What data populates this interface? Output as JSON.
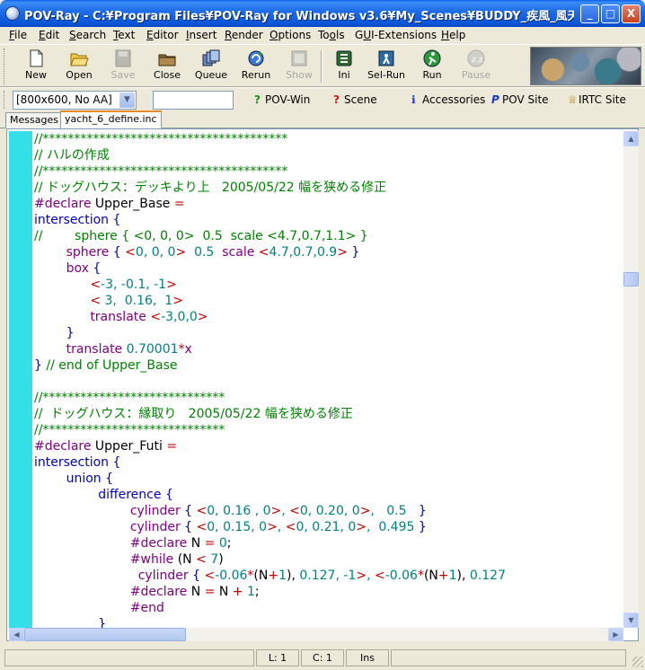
{
  "window": {
    "title": "POV-Ray - C:¥Program Files¥POV-Ray for Windows v3.6¥My_Scenes¥BUDDY_疾風_風天丸_at...",
    "minimize": "_",
    "maximize": "□",
    "close": "X"
  },
  "menu": [
    {
      "underline": "F",
      "rest": "ile"
    },
    {
      "underline": "E",
      "rest": "dit"
    },
    {
      "underline": "S",
      "rest": "earch",
      "pre": ""
    },
    {
      "underline": "T",
      "rest": "ext"
    },
    {
      "underline": "E",
      "rest": "ditor"
    },
    {
      "underline": "I",
      "rest": "nsert"
    },
    {
      "underline": "R",
      "rest": "ender"
    },
    {
      "underline": "O",
      "rest": "ptions"
    },
    {
      "underline": "o",
      "rest": "ls",
      "pre": "To"
    },
    {
      "underline": "U",
      "rest": "I-Extensions",
      "pre": "G"
    },
    {
      "underline": "H",
      "rest": "elp"
    }
  ],
  "toolbar": {
    "new": "New",
    "open": "Open",
    "save": "Save",
    "close": "Close",
    "queue": "Queue",
    "rerun": "Rerun",
    "show": "Show",
    "ini": "Ini",
    "selrun": "Sel-Run",
    "run": "Run",
    "pause": "Pause"
  },
  "bar2": {
    "resolution": "[800x600, No AA]",
    "povwin": "POV-Win",
    "scene": "Scene",
    "accessories": "Accessories",
    "povsite": "POV Site",
    "irtcsite": "IRTC Site"
  },
  "tabs": [
    "Messages",
    "yacht_6_define.inc"
  ],
  "code_lines": [
    [
      {
        "c": "com",
        "t": "//***************************************"
      }
    ],
    [
      {
        "c": "com",
        "t": "// ハルの作成"
      }
    ],
    [
      {
        "c": "com",
        "t": "//***************************************"
      }
    ],
    [
      {
        "c": "com",
        "t": "// ドッグハウス：デッキより上   2005/05/22 幅を狭める修正"
      }
    ],
    [
      {
        "c": "kw",
        "t": "#declare"
      },
      {
        "c": "",
        "t": " Upper_Base "
      },
      {
        "c": "op",
        "t": "="
      }
    ],
    [
      {
        "c": "blu",
        "t": "intersection"
      },
      {
        "c": "",
        "t": " "
      },
      {
        "c": "blu",
        "t": "{"
      }
    ],
    [
      {
        "c": "com",
        "t": "//        sphere { <0, 0, 0>  0.5  scale <4.7,0.7,1.1> }"
      }
    ],
    [
      {
        "c": "",
        "t": "        "
      },
      {
        "c": "kw",
        "t": "sphere"
      },
      {
        "c": "",
        "t": " "
      },
      {
        "c": "blu",
        "t": "{"
      },
      {
        "c": "",
        "t": " "
      },
      {
        "c": "op",
        "t": "<"
      },
      {
        "c": "num",
        "t": "0, 0, 0"
      },
      {
        "c": "op",
        "t": ">"
      },
      {
        "c": "",
        "t": "  "
      },
      {
        "c": "num",
        "t": "0.5"
      },
      {
        "c": "",
        "t": "  "
      },
      {
        "c": "kw",
        "t": "scale"
      },
      {
        "c": "",
        "t": " "
      },
      {
        "c": "op",
        "t": "<"
      },
      {
        "c": "num",
        "t": "4.7,0.7,0.9"
      },
      {
        "c": "op",
        "t": ">"
      },
      {
        "c": "",
        "t": " "
      },
      {
        "c": "blu",
        "t": "}"
      }
    ],
    [
      {
        "c": "",
        "t": "        "
      },
      {
        "c": "kw",
        "t": "box"
      },
      {
        "c": "",
        "t": " "
      },
      {
        "c": "blu",
        "t": "{"
      }
    ],
    [
      {
        "c": "",
        "t": "              "
      },
      {
        "c": "op",
        "t": "<"
      },
      {
        "c": "num",
        "t": "-3, -0.1, -1"
      },
      {
        "c": "op",
        "t": ">"
      }
    ],
    [
      {
        "c": "",
        "t": "              "
      },
      {
        "c": "op",
        "t": "<"
      },
      {
        "c": "num",
        "t": " 3,  0.16,  1"
      },
      {
        "c": "op",
        "t": ">"
      }
    ],
    [
      {
        "c": "",
        "t": "              "
      },
      {
        "c": "kw",
        "t": "translate"
      },
      {
        "c": "",
        "t": " "
      },
      {
        "c": "op",
        "t": "<"
      },
      {
        "c": "num",
        "t": "-3,0,0"
      },
      {
        "c": "op",
        "t": ">"
      }
    ],
    [
      {
        "c": "",
        "t": "        "
      },
      {
        "c": "blu",
        "t": "}"
      }
    ],
    [
      {
        "c": "",
        "t": "        "
      },
      {
        "c": "kw",
        "t": "translate"
      },
      {
        "c": "",
        "t": " "
      },
      {
        "c": "num",
        "t": "0.70001"
      },
      {
        "c": "op",
        "t": "*"
      },
      {
        "c": "kw",
        "t": "x"
      }
    ],
    [
      {
        "c": "blu",
        "t": "}"
      },
      {
        "c": "",
        "t": " "
      },
      {
        "c": "com",
        "t": "// end of Upper_Base"
      }
    ],
    [
      {
        "c": "",
        "t": ""
      }
    ],
    [
      {
        "c": "com",
        "t": "//*****************************"
      }
    ],
    [
      {
        "c": "com",
        "t": "//  ドッグハウス：縁取り   2005/05/22 幅を狭める修正"
      }
    ],
    [
      {
        "c": "com",
        "t": "//*****************************"
      }
    ],
    [
      {
        "c": "kw",
        "t": "#declare"
      },
      {
        "c": "",
        "t": " Upper_Futi "
      },
      {
        "c": "op",
        "t": "="
      }
    ],
    [
      {
        "c": "blu",
        "t": "intersection"
      },
      {
        "c": "",
        "t": " "
      },
      {
        "c": "blu",
        "t": "{"
      }
    ],
    [
      {
        "c": "",
        "t": "        "
      },
      {
        "c": "blu",
        "t": "union"
      },
      {
        "c": "",
        "t": " "
      },
      {
        "c": "blu",
        "t": "{"
      }
    ],
    [
      {
        "c": "",
        "t": "                "
      },
      {
        "c": "blu",
        "t": "difference"
      },
      {
        "c": "",
        "t": " "
      },
      {
        "c": "blu",
        "t": "{"
      }
    ],
    [
      {
        "c": "",
        "t": "                        "
      },
      {
        "c": "kw",
        "t": "cylinder"
      },
      {
        "c": "",
        "t": " "
      },
      {
        "c": "blu",
        "t": "{"
      },
      {
        "c": "",
        "t": " "
      },
      {
        "c": "op",
        "t": "<"
      },
      {
        "c": "num",
        "t": "0, 0.16 , 0"
      },
      {
        "c": "op",
        "t": ">"
      },
      {
        "c": "num",
        "t": ", "
      },
      {
        "c": "op",
        "t": "<"
      },
      {
        "c": "num",
        "t": "0, 0.20, 0"
      },
      {
        "c": "op",
        "t": ">"
      },
      {
        "c": "num",
        "t": ",   0.5   "
      },
      {
        "c": "blu",
        "t": "}"
      }
    ],
    [
      {
        "c": "",
        "t": "                        "
      },
      {
        "c": "kw",
        "t": "cylinder"
      },
      {
        "c": "",
        "t": " "
      },
      {
        "c": "blu",
        "t": "{"
      },
      {
        "c": "",
        "t": " "
      },
      {
        "c": "op",
        "t": "<"
      },
      {
        "c": "num",
        "t": "0, 0.15, 0"
      },
      {
        "c": "op",
        "t": ">"
      },
      {
        "c": "num",
        "t": ", "
      },
      {
        "c": "op",
        "t": "<"
      },
      {
        "c": "num",
        "t": "0, 0.21, 0"
      },
      {
        "c": "op",
        "t": ">"
      },
      {
        "c": "num",
        "t": ",  0.495 "
      },
      {
        "c": "blu",
        "t": "}"
      }
    ],
    [
      {
        "c": "",
        "t": "                        "
      },
      {
        "c": "kw",
        "t": "#declare"
      },
      {
        "c": "",
        "t": " N "
      },
      {
        "c": "op",
        "t": "="
      },
      {
        "c": "",
        "t": " "
      },
      {
        "c": "num",
        "t": "0"
      },
      {
        "c": "",
        "t": ";"
      }
    ],
    [
      {
        "c": "",
        "t": "                        "
      },
      {
        "c": "kw",
        "t": "#while"
      },
      {
        "c": "",
        "t": " (N "
      },
      {
        "c": "op",
        "t": "<"
      },
      {
        "c": "",
        "t": " "
      },
      {
        "c": "num",
        "t": "7"
      },
      {
        "c": "",
        "t": ")"
      }
    ],
    [
      {
        "c": "",
        "t": "                          "
      },
      {
        "c": "kw",
        "t": "cylinder"
      },
      {
        "c": "",
        "t": " "
      },
      {
        "c": "blu",
        "t": "{"
      },
      {
        "c": "",
        "t": " "
      },
      {
        "c": "op",
        "t": "<"
      },
      {
        "c": "num",
        "t": "-0.06"
      },
      {
        "c": "op",
        "t": "*"
      },
      {
        "c": "",
        "t": "(N"
      },
      {
        "c": "op",
        "t": "+"
      },
      {
        "c": "num",
        "t": "1"
      },
      {
        "c": "",
        "t": "), "
      },
      {
        "c": "num",
        "t": "0.127, -1"
      },
      {
        "c": "op",
        "t": ">"
      },
      {
        "c": "num",
        "t": ", "
      },
      {
        "c": "op",
        "t": "<"
      },
      {
        "c": "num",
        "t": "-0.06"
      },
      {
        "c": "op",
        "t": "*"
      },
      {
        "c": "",
        "t": "(N"
      },
      {
        "c": "op",
        "t": "+"
      },
      {
        "c": "num",
        "t": "1"
      },
      {
        "c": "",
        "t": "), "
      },
      {
        "c": "num",
        "t": "0.127"
      }
    ],
    [
      {
        "c": "",
        "t": "                        "
      },
      {
        "c": "kw",
        "t": "#declare"
      },
      {
        "c": "",
        "t": " N "
      },
      {
        "c": "op",
        "t": "="
      },
      {
        "c": "",
        "t": " N "
      },
      {
        "c": "op",
        "t": "+"
      },
      {
        "c": "",
        "t": " "
      },
      {
        "c": "num",
        "t": "1"
      },
      {
        "c": "",
        "t": ";"
      }
    ],
    [
      {
        "c": "",
        "t": "                        "
      },
      {
        "c": "kw",
        "t": "#end"
      }
    ],
    [
      {
        "c": "",
        "t": "                "
      },
      {
        "c": "blu",
        "t": "}"
      }
    ]
  ],
  "status": {
    "line": "L: 1",
    "col": "C: 1",
    "mode": "Ins"
  }
}
